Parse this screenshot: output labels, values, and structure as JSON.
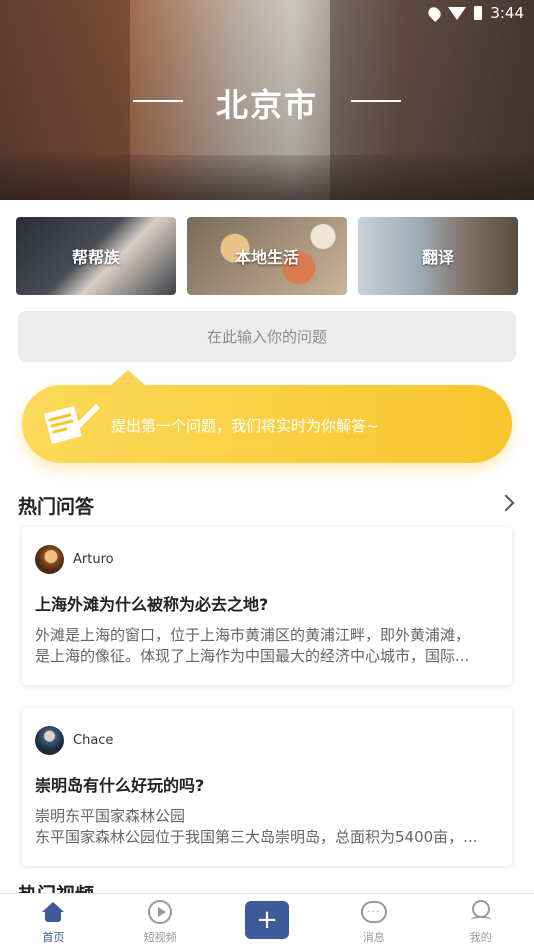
{
  "status": {
    "time": "3:44",
    "icons": [
      "location-icon",
      "wifi-icon",
      "battery-icon"
    ]
  },
  "hero": {
    "city": "北京市"
  },
  "categories": [
    {
      "label": "帮帮族"
    },
    {
      "label": "本地生活"
    },
    {
      "label": "翻译"
    }
  ],
  "search": {
    "placeholder": "在此输入你的问题"
  },
  "banner": {
    "text": "提出第一个问题，我们将实时为你解答~",
    "icon": "pen-paper-icon"
  },
  "hot_qa": {
    "title": "热门问答",
    "items": [
      {
        "user": "Arturo",
        "question": "上海外滩为什么被称为必去之地?",
        "answer_lines": [
          " 外滩是上海的窗口，位于上海市黄浦区的黄浦江畔，即外黄浦滩，",
          "是上海的像征。体现了上海作为中国最大的经济中心城市，国际..."
        ]
      },
      {
        "user": "Chace",
        "question": "崇明岛有什么好玩的吗?",
        "answer_lines": [
          "崇明东平国家森林公园",
          "东平国家森林公园位于我国第三大岛崇明岛，总面积为5400亩，..."
        ]
      }
    ]
  },
  "next_section": {
    "title": "热门视频"
  },
  "tabbar": {
    "items": [
      {
        "label": "首页",
        "icon": "home-icon",
        "active": true
      },
      {
        "label": "短视频",
        "icon": "play-icon"
      },
      {
        "label": "",
        "icon": "plus-icon"
      },
      {
        "label": "消息",
        "icon": "message-icon"
      },
      {
        "label": "我的",
        "icon": "profile-icon"
      }
    ]
  },
  "colors": {
    "accent": "#3e5a9a",
    "banner": "#f8c62e"
  }
}
